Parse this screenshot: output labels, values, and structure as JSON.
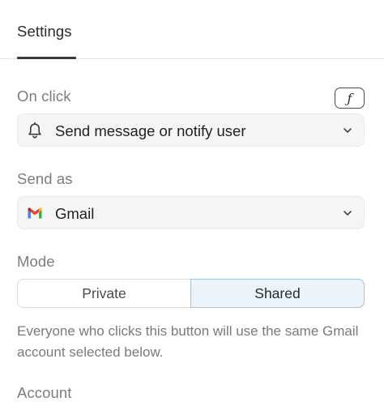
{
  "tabs": {
    "settings": "Settings"
  },
  "on_click": {
    "label": "On click",
    "fn_symbol": "ƒ",
    "value": "Send message or notify user",
    "icon": "bell-icon"
  },
  "send_as": {
    "label": "Send as",
    "value": "Gmail",
    "icon": "gmail-icon"
  },
  "mode": {
    "label": "Mode",
    "options": [
      "Private",
      "Shared"
    ],
    "selected": "Shared",
    "hint": "Everyone who clicks this button will use the same Gmail account selected below."
  },
  "account": {
    "label": "Account"
  },
  "colors": {
    "accent_bg": "#ecf4fb",
    "accent_border": "#9cc6e8",
    "gmail_red": "#ea4335",
    "gmail_blue": "#4285f4",
    "gmail_green": "#34a853",
    "gmail_yellow": "#fbbc04"
  }
}
